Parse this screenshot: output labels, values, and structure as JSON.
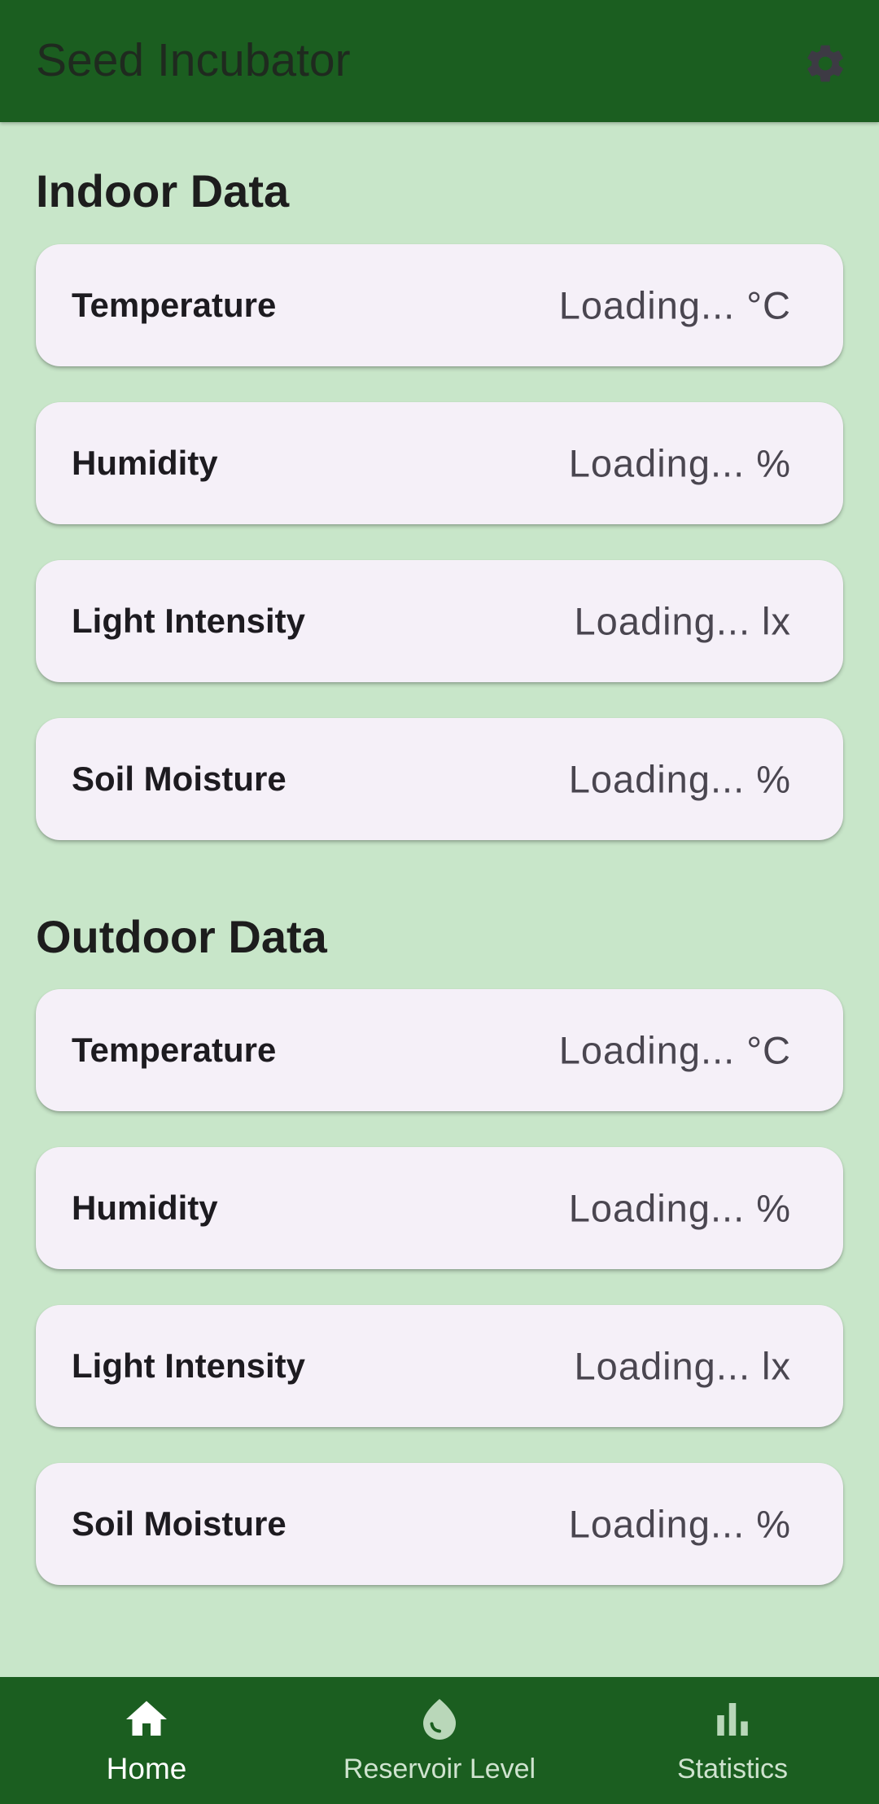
{
  "app_bar": {
    "title": "Seed Incubator",
    "settings_icon": "gear-icon"
  },
  "indoor": {
    "title": "Indoor Data",
    "cards": [
      {
        "label": "Temperature",
        "value": "Loading... °C"
      },
      {
        "label": "Humidity",
        "value": "Loading... %"
      },
      {
        "label": "Light Intensity",
        "value": "Loading... lx"
      },
      {
        "label": "Soil Moisture",
        "value": "Loading... %"
      }
    ]
  },
  "outdoor": {
    "title": "Outdoor Data",
    "cards": [
      {
        "label": "Temperature",
        "value": "Loading... °C"
      },
      {
        "label": "Humidity",
        "value": "Loading... %"
      },
      {
        "label": "Light Intensity",
        "value": "Loading... lx"
      },
      {
        "label": "Soil Moisture",
        "value": "Loading... %"
      }
    ]
  },
  "bottom_nav": {
    "items": [
      {
        "label": "Home",
        "icon": "home-icon",
        "active": true
      },
      {
        "label": "Reservoir Level",
        "icon": "water-drop-icon",
        "active": false
      },
      {
        "label": "Statistics",
        "icon": "bar-chart-icon",
        "active": false
      }
    ]
  },
  "colors": {
    "app_bar": "#1b5e20",
    "background": "#c8e6c9",
    "card": "#f5f0f8"
  }
}
